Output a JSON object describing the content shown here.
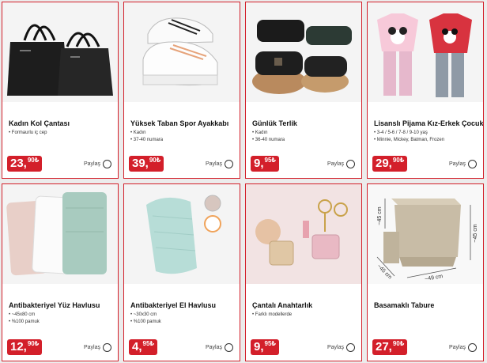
{
  "share_label": "Paylaş",
  "products": [
    {
      "title": "Kadın Kol Çantası",
      "features": [
        "Formaurlu iç cep"
      ],
      "price_int": "23,",
      "price_dec": "90₺",
      "image_icon": "black-tote-bags-icon"
    },
    {
      "title": "Yüksek Taban Spor Ayakkabı",
      "features": [
        "Kadın",
        "37-40 numara"
      ],
      "price_int": "39,",
      "price_dec": "90₺",
      "image_icon": "white-sneakers-icon"
    },
    {
      "title": "Günlük Terlik",
      "features": [
        "Kadın",
        "36-40 numara"
      ],
      "price_int": "9,",
      "price_dec": "95₺",
      "image_icon": "slippers-icon"
    },
    {
      "title": "Lisanslı Pijama Kız-Erkek Çocuk",
      "features": [
        "3-4 / 5-6 / 7-8 / 9-10 yaş",
        "Minnie, Mickey, Batman, Frozen"
      ],
      "price_int": "29,",
      "price_dec": "90₺",
      "image_icon": "kids-pajamas-icon"
    },
    {
      "title": "Antibakteriyel Yüz Havlusu",
      "features": [
        "~45x80 cm",
        "%100 pamuk"
      ],
      "price_int": "12,",
      "price_dec": "90₺",
      "image_icon": "folded-towels-icon"
    },
    {
      "title": "Antibakteriyel El Havlusu",
      "features": [
        "~30x30 cm",
        "%100 pamuk"
      ],
      "price_int": "4,",
      "price_dec": "95₺",
      "image_icon": "hand-towel-icon"
    },
    {
      "title": "Çantalı Anahtarlık",
      "features": [
        "Farklı modellerde"
      ],
      "price_int": "9,",
      "price_dec": "95₺",
      "image_icon": "bag-keychain-icon"
    },
    {
      "title": "Basamaklı Tabure",
      "features": [],
      "price_int": "27,",
      "price_dec": "90₺",
      "image_icon": "step-stool-icon"
    }
  ],
  "stool_dims": {
    "w1": "~45 cm",
    "h": "~45 cm",
    "d": "~45 cm",
    "w2": "~49 cm"
  }
}
